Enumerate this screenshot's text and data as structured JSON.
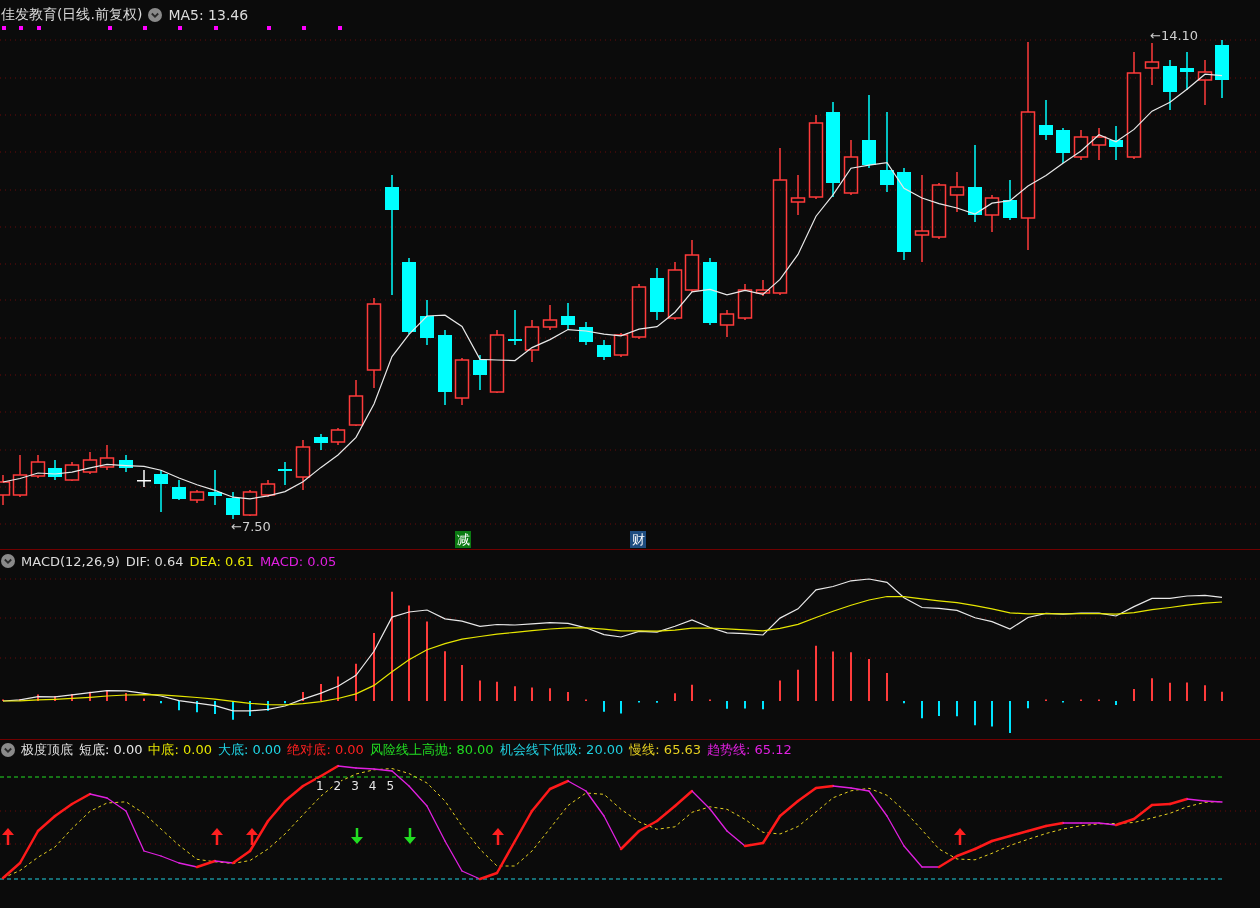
{
  "price_panel": {
    "title": "佳发教育(日线.前复权)",
    "ma_label": "MA5: 13.46",
    "high_marker": "←14.10",
    "low_marker": "←7.50",
    "event_badges": [
      {
        "label": "减",
        "color": "#0b7a12"
      },
      {
        "label": "财",
        "color": "#1d4c80"
      }
    ]
  },
  "macd_panel": {
    "title": "MACD(12,26,9)",
    "readings": [
      {
        "text": "DIF: 0.64",
        "color": "#dcdcdc"
      },
      {
        "text": "DEA: 0.61",
        "color": "#e6e600"
      },
      {
        "text": "MACD: 0.05",
        "color": "#e020e0"
      }
    ]
  },
  "indicator_panel": {
    "title": "极度顶底",
    "readings": [
      {
        "text": "短底: 0.00",
        "color": "#e6e6e6"
      },
      {
        "text": "中底: 0.00",
        "color": "#e6e600"
      },
      {
        "text": "大底: 0.00",
        "color": "#20d8e8"
      },
      {
        "text": "绝对底: 0.00",
        "color": "#ff2020"
      },
      {
        "text": "风险线上高抛: 80.00",
        "color": "#22dd22"
      },
      {
        "text": "机会线下低吸: 20.00",
        "color": "#20d0e0"
      },
      {
        "text": "慢线: 65.63",
        "color": "#e6d020"
      },
      {
        "text": "趋势线: 65.12",
        "color": "#e020e0"
      }
    ],
    "peak_labels": [
      "1",
      "2",
      "3",
      "4",
      "5"
    ]
  }
}
